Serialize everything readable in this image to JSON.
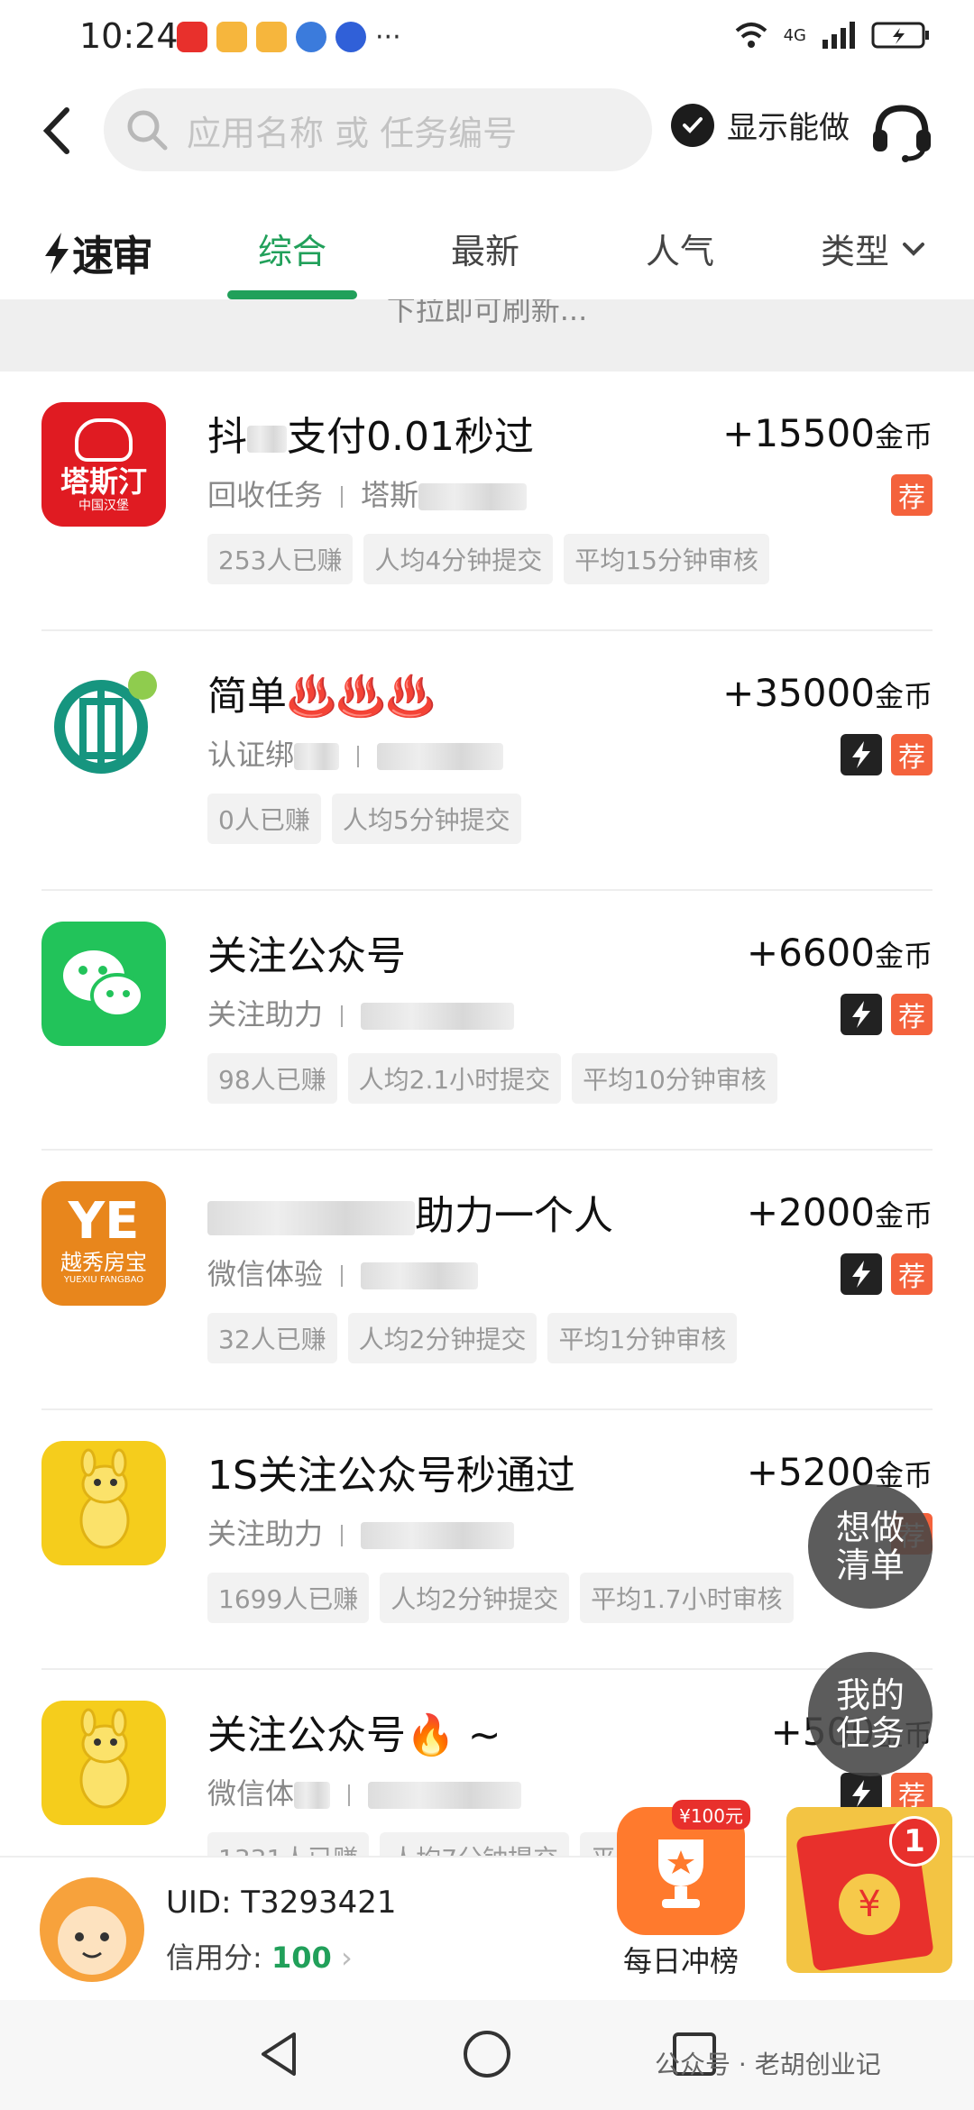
{
  "status_bar": {
    "time": "10:24",
    "more": "···",
    "network": "4G"
  },
  "header": {
    "search_placeholder": "应用名称 或 任务编号",
    "show_doable_label": "显示能做"
  },
  "tabs": {
    "logo": "速审",
    "items": [
      "综合",
      "最新",
      "人气"
    ],
    "type_label": "类型"
  },
  "refresh_hint": "下拉即可刷新...",
  "tasks": [
    {
      "title_prefix": "抖",
      "title_suffix": "支付0.01秒过",
      "reward": "+15500",
      "unit": "金币",
      "category": "回收任务",
      "app_prefix": "塔斯",
      "chips": [
        "253人已赚",
        "人均4分钟提交",
        "平均15分钟审核"
      ],
      "badges": [
        "荐"
      ],
      "icon_text": "塔斯汀",
      "icon_sub": "中国汉堡"
    },
    {
      "title": "简单♨️♨️♨️",
      "reward": "+35000",
      "unit": "金币",
      "category": "认证绑",
      "chips": [
        "0人已赚",
        "人均5分钟提交"
      ],
      "badges": [
        "fast",
        "荐"
      ]
    },
    {
      "title": "关注公众号",
      "reward": "+6600",
      "unit": "金币",
      "category": "关注助力",
      "chips": [
        "98人已赚",
        "人均2.1小时提交",
        "平均10分钟审核"
      ],
      "badges": [
        "fast",
        "荐"
      ]
    },
    {
      "title_suffix": "助力一个人",
      "reward": "+2000",
      "unit": "金币",
      "category": "微信体验",
      "chips": [
        "32人已赚",
        "人均2分钟提交",
        "平均1分钟审核"
      ],
      "badges": [
        "fast",
        "荐"
      ],
      "icon_text": "越秀房宝",
      "icon_sub": "YUEXIU FANGBAO"
    },
    {
      "title": "1S关注公众号秒通过",
      "reward": "+5200",
      "unit": "金币",
      "category": "关注助力",
      "chips": [
        "1699人已赚",
        "人均2分钟提交",
        "平均1.7小时审核"
      ],
      "badges": [
        "荐"
      ]
    },
    {
      "title": "关注公众号🔥 ~",
      "reward": "+500",
      "unit": "金币",
      "category": "微信体",
      "chips": [
        "1331人已赚",
        "人均7分钟提交",
        "平"
      ],
      "badges": [
        "fast",
        "荐"
      ]
    }
  ],
  "floating": {
    "wishlist": "想做清单",
    "my_tasks": "我的任务"
  },
  "bottom": {
    "uid": "UID: T3293421",
    "credit_label": "信用分: ",
    "credit_value": "100",
    "rank_label": "每日冲榜",
    "rank_prize": "¥100元",
    "redpack_count": "1",
    "coin": "¥"
  },
  "watermark": "公众号 · 老胡创业记",
  "colors": {
    "accent": "#21a05a",
    "recommend": "#f4623c"
  }
}
